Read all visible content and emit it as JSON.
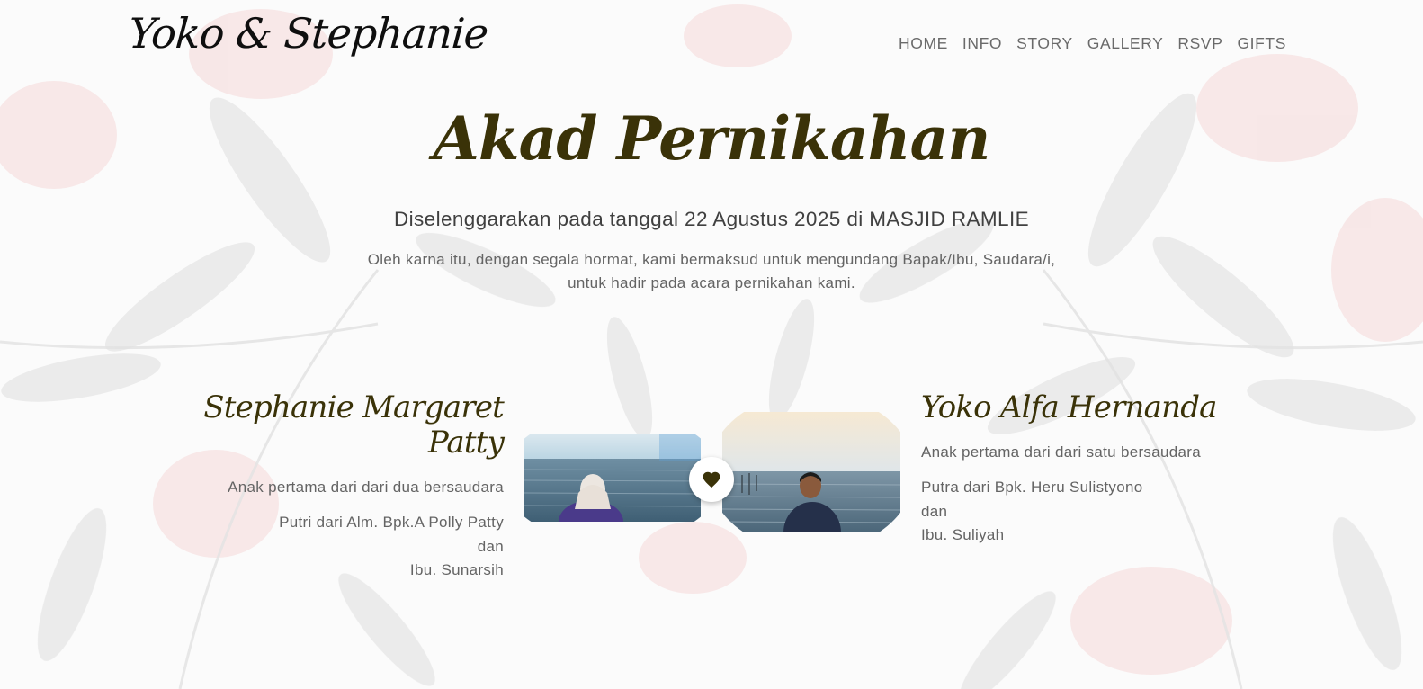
{
  "header": {
    "brand": "Yoko & Stephanie",
    "nav": [
      "HOME",
      "INFO",
      "STORY",
      "GALLERY",
      "RSVP",
      "GIFTS"
    ]
  },
  "hero": {
    "title": "Akad Pernikahan",
    "subtitle": "Diselenggarakan pada tanggal 22 Agustus 2025 di MASJID RAMLIE",
    "description_lines": [
      "Oleh karna itu, dengan segala hormat, kami bermaksud untuk mengundang Bapak/Ibu, Saudara/i,",
      "untuk hadir pada acara pernikahan kami."
    ]
  },
  "bride": {
    "name": "Stephanie Margaret Patty",
    "order": "Anak pertama dari dari dua bersaudara",
    "parents": [
      "Putri dari Alm. Bpk.A Polly Patty",
      "dan",
      "Ibu. Sunarsih"
    ]
  },
  "groom": {
    "name": "Yoko Alfa Hernanda",
    "order": "Anak pertama dari dari satu bersaudara",
    "parents": [
      "Putra dari Bpk. Heru Sulistyono",
      "dan",
      "Ibu. Suliyah"
    ]
  },
  "icons": {
    "center": "heart-icon"
  },
  "colors": {
    "accent": "#3a3208",
    "text": "#646464",
    "heading": "#404040",
    "nav": "#6a6a6a"
  }
}
